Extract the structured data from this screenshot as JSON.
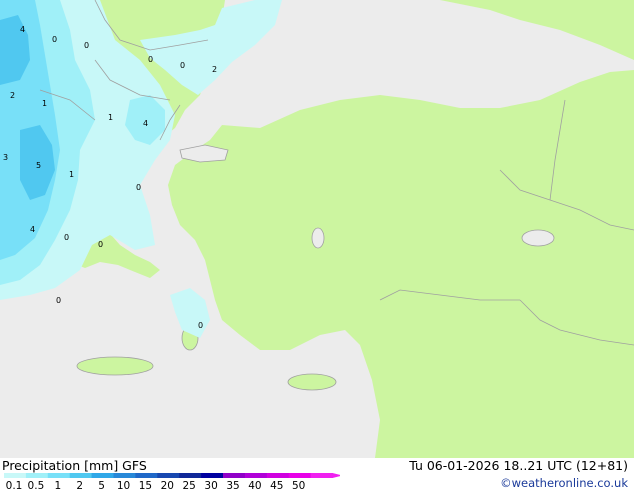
{
  "header": {
    "title": "Precipitation [mm]  GFS",
    "valid_time": "Tu 06-01-2026 18..21 UTC (12+81)",
    "credit": "©weatheronline.co.uk"
  },
  "legend": {
    "ticks": [
      "0.1",
      "0.5",
      "1",
      "2",
      "5",
      "10",
      "15",
      "20",
      "25",
      "30",
      "35",
      "40",
      "45",
      "50"
    ],
    "colors": [
      "#c8f8f8",
      "#a0f0f8",
      "#78e0f8",
      "#50c8f0",
      "#30a8e8",
      "#2888d8",
      "#2068c8",
      "#1848b0",
      "#102898",
      "#0000a0",
      "#9000c8",
      "#b000d8",
      "#d000e0",
      "#e800e8",
      "#f020f0"
    ]
  },
  "map": {
    "land_color": "#ccf5a0",
    "sea_color": "#ececec",
    "border_color": "#a0a0a0",
    "contour_labels": [
      "4",
      "0",
      "0",
      "0",
      "0",
      "2",
      "1",
      "2",
      "1",
      "4",
      "3",
      "5",
      "1",
      "0",
      "4",
      "0",
      "0",
      "0",
      "0"
    ]
  }
}
